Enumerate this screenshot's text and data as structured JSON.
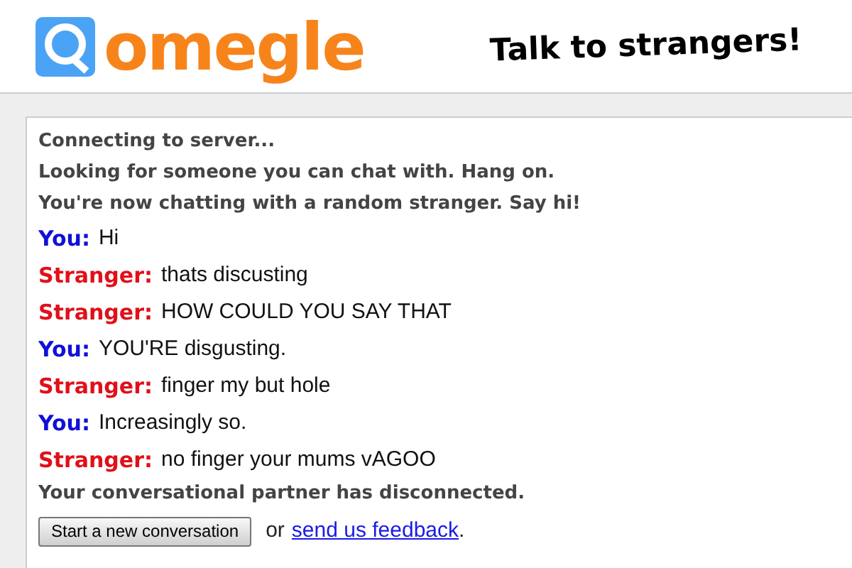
{
  "header": {
    "logo": "omegle",
    "tagline": "Talk to strangers!"
  },
  "log": [
    {
      "kind": "status",
      "text": "Connecting to server..."
    },
    {
      "kind": "status",
      "text": "Looking for someone you can chat with. Hang on."
    },
    {
      "kind": "status",
      "text": "You're now chatting with a random stranger. Say hi!"
    },
    {
      "kind": "you",
      "speaker": "You:",
      "text": "Hi"
    },
    {
      "kind": "stranger",
      "speaker": "Stranger:",
      "text": "thats discusting"
    },
    {
      "kind": "stranger",
      "speaker": "Stranger:",
      "text": "HOW COULD YOU SAY THAT"
    },
    {
      "kind": "you",
      "speaker": "You:",
      "text": "YOU'RE disgusting."
    },
    {
      "kind": "stranger",
      "speaker": "Stranger:",
      "text": "finger my but hole"
    },
    {
      "kind": "you",
      "speaker": "You:",
      "text": "Increasingly so."
    },
    {
      "kind": "stranger",
      "speaker": "Stranger:",
      "text": "no finger your mums vAGOO"
    },
    {
      "kind": "status",
      "text": "Your conversational partner has disconnected."
    }
  ],
  "footer": {
    "button": "Start a new conversation",
    "or": "or",
    "link": "send us feedback",
    "end": "."
  }
}
